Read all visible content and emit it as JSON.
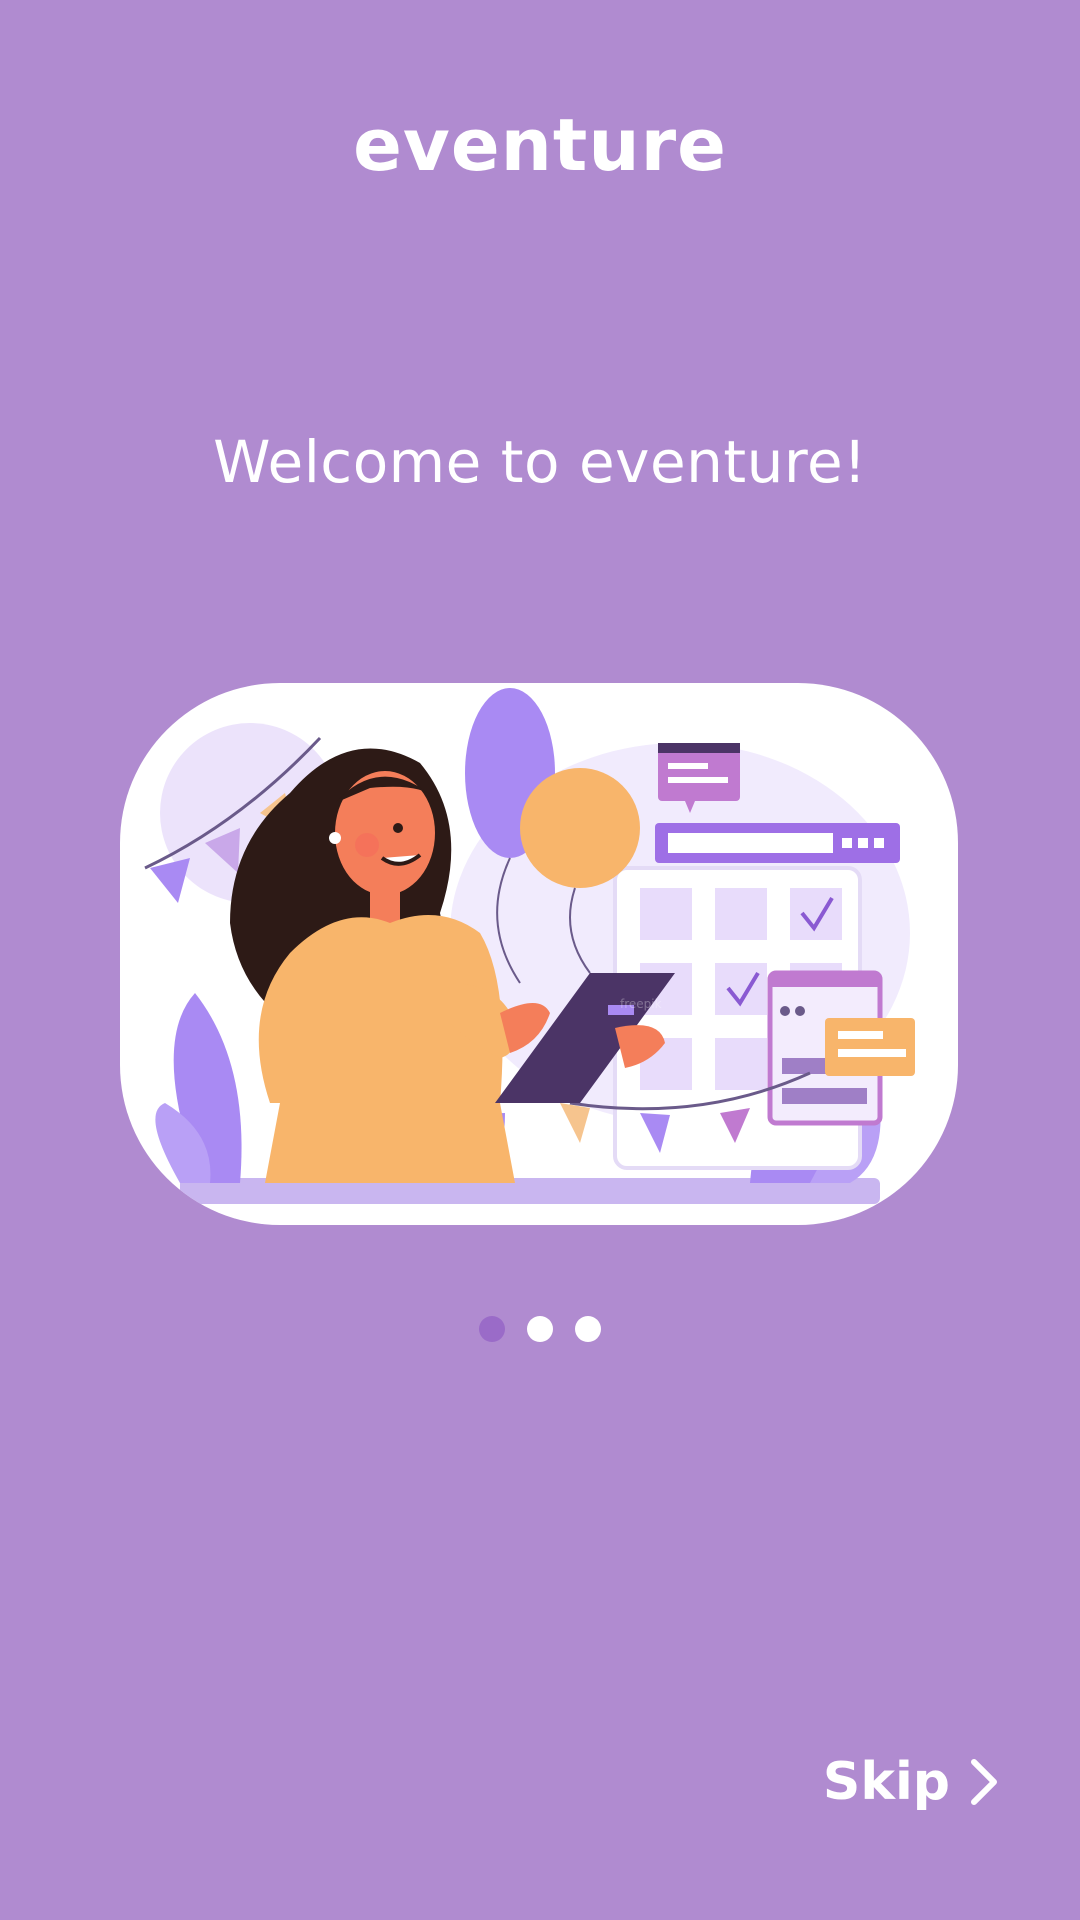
{
  "app": {
    "title": "eventure"
  },
  "onboarding": {
    "headline": "Welcome to eventure!",
    "illustration_icon": "woman-with-tablet-calendar-illustration",
    "pager": {
      "total": 3,
      "active_index": 0
    }
  },
  "footer": {
    "skip_label": "Skip",
    "skip_icon": "chevron-right-icon"
  },
  "colors": {
    "background": "#b08bd0",
    "accent": "#9a6bc8",
    "text": "#ffffff"
  }
}
